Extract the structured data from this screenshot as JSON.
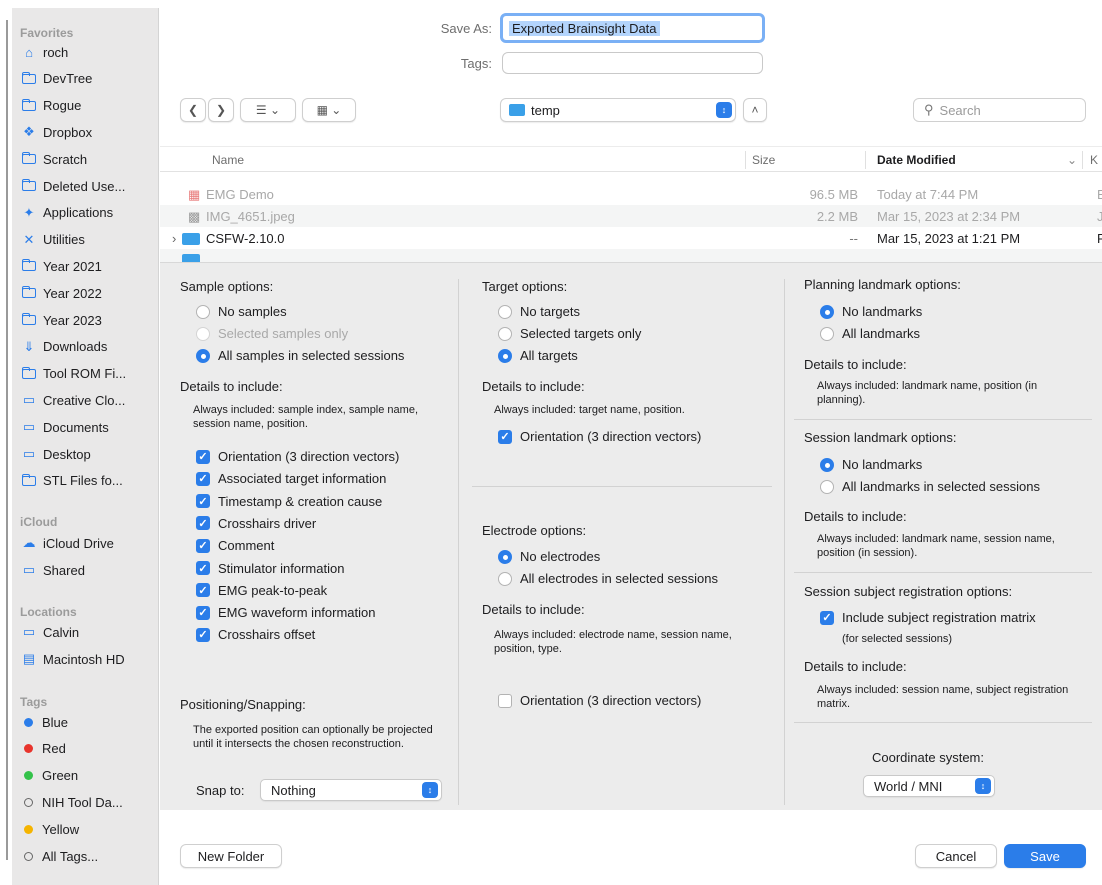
{
  "sidebar": {
    "favorites_header": "Favorites",
    "favorites": [
      {
        "label": "roch",
        "icon": "home-icon"
      },
      {
        "label": "DevTree",
        "icon": "folder-icon"
      },
      {
        "label": "Rogue",
        "icon": "folder-icon"
      },
      {
        "label": "Dropbox",
        "icon": "dropbox-icon"
      },
      {
        "label": "Scratch",
        "icon": "folder-icon"
      },
      {
        "label": "Deleted Use...",
        "icon": "folder-icon"
      },
      {
        "label": "Applications",
        "icon": "applications-icon"
      },
      {
        "label": "Utilities",
        "icon": "utilities-icon"
      },
      {
        "label": "Year 2021",
        "icon": "folder-icon"
      },
      {
        "label": "Year 2022",
        "icon": "folder-icon"
      },
      {
        "label": "Year 2023",
        "icon": "folder-icon"
      },
      {
        "label": "Downloads",
        "icon": "downloads-icon"
      },
      {
        "label": "Tool ROM Fi...",
        "icon": "folder-icon"
      },
      {
        "label": "Creative Clo...",
        "icon": "document-icon"
      },
      {
        "label": "Documents",
        "icon": "document-icon"
      },
      {
        "label": "Desktop",
        "icon": "desktop-icon"
      },
      {
        "label": "STL Files fo...",
        "icon": "folder-icon"
      }
    ],
    "icloud_header": "iCloud",
    "icloud": [
      {
        "label": "iCloud Drive",
        "icon": "cloud-icon"
      },
      {
        "label": "Shared",
        "icon": "shared-folder-icon"
      }
    ],
    "locations_header": "Locations",
    "locations": [
      {
        "label": "Calvin",
        "icon": "computer-icon"
      },
      {
        "label": "Macintosh HD",
        "icon": "disk-icon"
      }
    ],
    "tags_header": "Tags",
    "tags": [
      {
        "label": "Blue",
        "color": "#2b7de9"
      },
      {
        "label": "Red",
        "color": "#e8342c"
      },
      {
        "label": "Green",
        "color": "#34c24a"
      },
      {
        "label": "NIH Tool Da...",
        "color": "hollow"
      },
      {
        "label": "Yellow",
        "color": "#f5b400"
      },
      {
        "label": "All Tags...",
        "color": "all-tags"
      }
    ]
  },
  "save_as": {
    "label": "Save As:",
    "value": "Exported Brainsight Data"
  },
  "tags_field": {
    "label": "Tags:",
    "value": ""
  },
  "toolbar": {
    "location": "temp",
    "search_placeholder": "Search"
  },
  "file_list": {
    "columns": [
      "Name",
      "Size",
      "Date Modified",
      "K"
    ],
    "rows": [
      {
        "name": "EMG Demo",
        "size": "96.5 MB",
        "date": "Today at 7:44 PM",
        "kind": "E"
      },
      {
        "name": "IMG_4651.jpeg",
        "size": "2.2 MB",
        "date": "Mar 15, 2023 at 2:34 PM",
        "kind": "J"
      },
      {
        "name": "CSFW-2.10.0",
        "size": "--",
        "date": "Mar 15, 2023 at 1:21 PM",
        "kind": "F"
      }
    ]
  },
  "sample_options": {
    "title": "Sample options:",
    "radios": [
      "No samples",
      "Selected samples only",
      "All samples in selected sessions"
    ],
    "details_title": "Details to include:",
    "note": "Always included: sample index, sample name, session name, position.",
    "checks": [
      "Orientation (3 direction vectors)",
      "Associated target information",
      "Timestamp & creation cause",
      "Crosshairs driver",
      "Comment",
      "Stimulator information",
      "EMG peak-to-peak",
      "EMG waveform information",
      "Crosshairs offset"
    ]
  },
  "positioning": {
    "title": "Positioning/Snapping:",
    "note": "The exported position can optionally be projected until it intersects the chosen reconstruction.",
    "snap_label": "Snap to:",
    "snap_value": "Nothing"
  },
  "target_options": {
    "title": "Target options:",
    "radios": [
      "No targets",
      "Selected targets only",
      "All targets"
    ],
    "details_title": "Details to include:",
    "note": "Always included: target name, position.",
    "check": "Orientation (3 direction vectors)"
  },
  "electrode_options": {
    "title": "Electrode options:",
    "radios": [
      "No electrodes",
      "All electrodes in selected sessions"
    ],
    "details_title": "Details to include:",
    "note": "Always included: electrode name, session name, position, type.",
    "check": "Orientation (3 direction vectors)"
  },
  "planning_landmark": {
    "title": "Planning landmark options:",
    "radios": [
      "No landmarks",
      "All landmarks"
    ],
    "details_title": "Details to include:",
    "note": "Always included: landmark name, position (in planning)."
  },
  "session_landmark": {
    "title": "Session landmark options:",
    "radios": [
      "No landmarks",
      "All landmarks in selected sessions"
    ],
    "details_title": "Details to include:",
    "note": "Always included: landmark name, session name, position (in session)."
  },
  "registration": {
    "title": "Session subject registration options:",
    "check": "Include subject registration matrix",
    "sub": "(for selected sessions)",
    "details_title": "Details to include:",
    "note": "Always included: session name, subject registration matrix."
  },
  "coordinate": {
    "label": "Coordinate system:",
    "value": "World / MNI"
  },
  "buttons": {
    "new_folder": "New Folder",
    "cancel": "Cancel",
    "save": "Save"
  }
}
